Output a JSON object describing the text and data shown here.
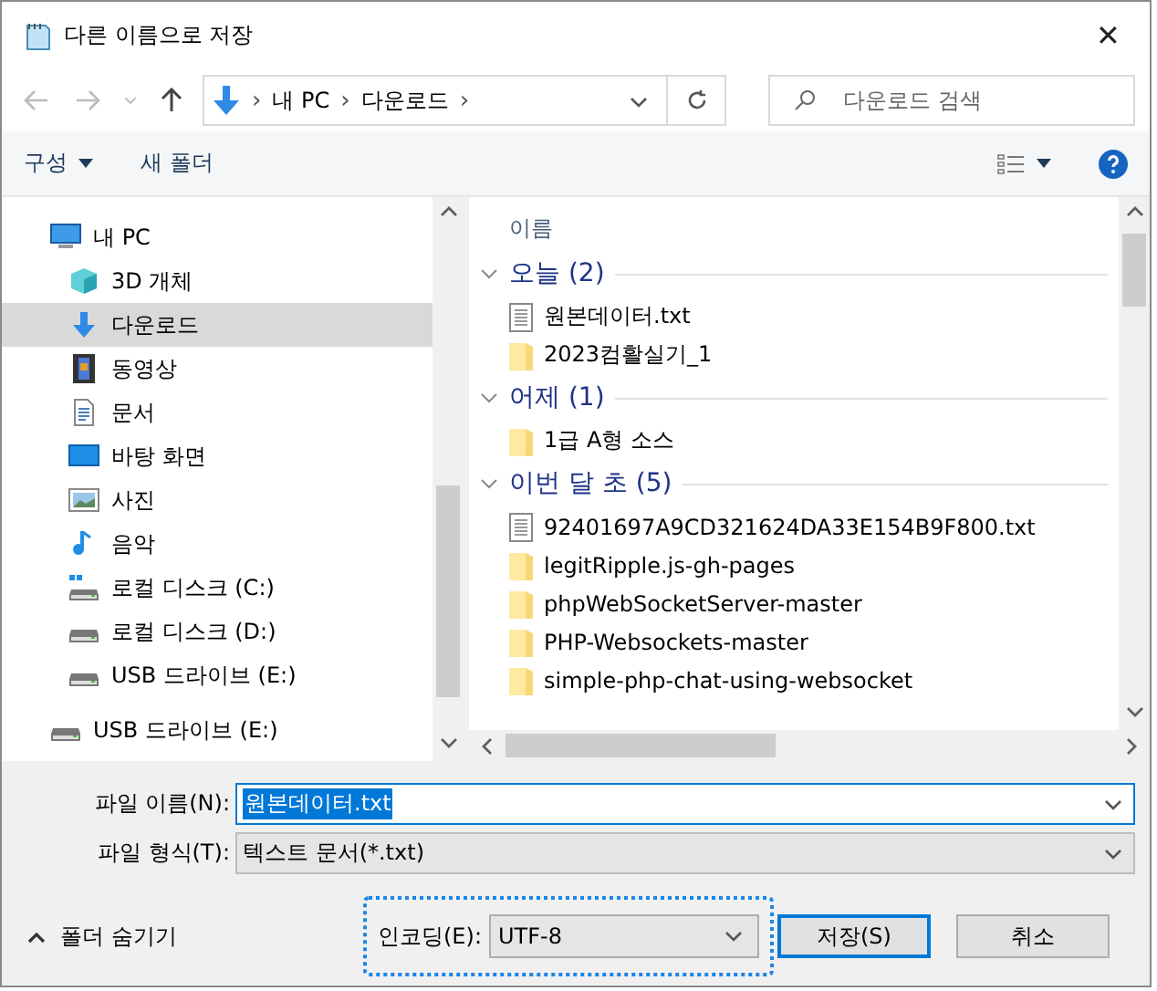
{
  "window": {
    "title": "다른 이름으로 저장",
    "close": "✕"
  },
  "address": {
    "path": [
      "내 PC",
      "다운로드"
    ],
    "separator": "›"
  },
  "search": {
    "placeholder": "다운로드 검색"
  },
  "toolbar": {
    "organize": "구성",
    "new_folder": "새 폴더"
  },
  "nav": [
    {
      "label": "내 PC",
      "kind": "pc",
      "selected": false,
      "children": [
        {
          "label": "3D 개체",
          "kind": "cube",
          "selected": false
        },
        {
          "label": "다운로드",
          "kind": "download",
          "selected": true
        },
        {
          "label": "동영상",
          "kind": "video",
          "selected": false
        },
        {
          "label": "문서",
          "kind": "doc",
          "selected": false
        },
        {
          "label": "바탕 화면",
          "kind": "desktop",
          "selected": false
        },
        {
          "label": "사진",
          "kind": "photo",
          "selected": false
        },
        {
          "label": "음악",
          "kind": "music",
          "selected": false
        },
        {
          "label": "로컬 디스크 (C:)",
          "kind": "sysdrive",
          "selected": false
        },
        {
          "label": "로컬 디스크 (D:)",
          "kind": "drive",
          "selected": false
        },
        {
          "label": "USB 드라이브 (E:)",
          "kind": "drive",
          "selected": false
        }
      ]
    },
    {
      "label": "USB 드라이브 (E:)",
      "kind": "drive",
      "selected": false
    }
  ],
  "files": {
    "column": "이름",
    "groups": [
      {
        "label": "오늘 (2)",
        "expanded": true,
        "items": [
          {
            "name": "원본데이터.txt",
            "kind": "txt"
          },
          {
            "name": "2023컴활실기_1",
            "kind": "folder"
          }
        ]
      },
      {
        "label": "어제 (1)",
        "expanded": true,
        "items": [
          {
            "name": "1급 A형 소스",
            "kind": "folder"
          }
        ]
      },
      {
        "label": "이번 달 초 (5)",
        "expanded": true,
        "items": [
          {
            "name": "92401697A9CD321624DA33E154B9F800.txt",
            "kind": "txt"
          },
          {
            "name": "legitRipple.js-gh-pages",
            "kind": "folder"
          },
          {
            "name": "phpWebSocketServer-master",
            "kind": "folder"
          },
          {
            "name": "PHP-Websockets-master",
            "kind": "folder"
          },
          {
            "name": "simple-php-chat-using-websocket",
            "kind": "folder"
          }
        ]
      }
    ]
  },
  "form": {
    "filename_label": "파일 이름(N):",
    "filename": "원본데이터.txt",
    "type_label": "파일 형식(T):",
    "type": "텍스트 문서(*.txt)"
  },
  "footer": {
    "hide_folders": "폴더 숨기기",
    "encoding_label": "인코딩(E):",
    "encoding": "UTF-8",
    "save": "저장(S)",
    "cancel": "취소"
  }
}
